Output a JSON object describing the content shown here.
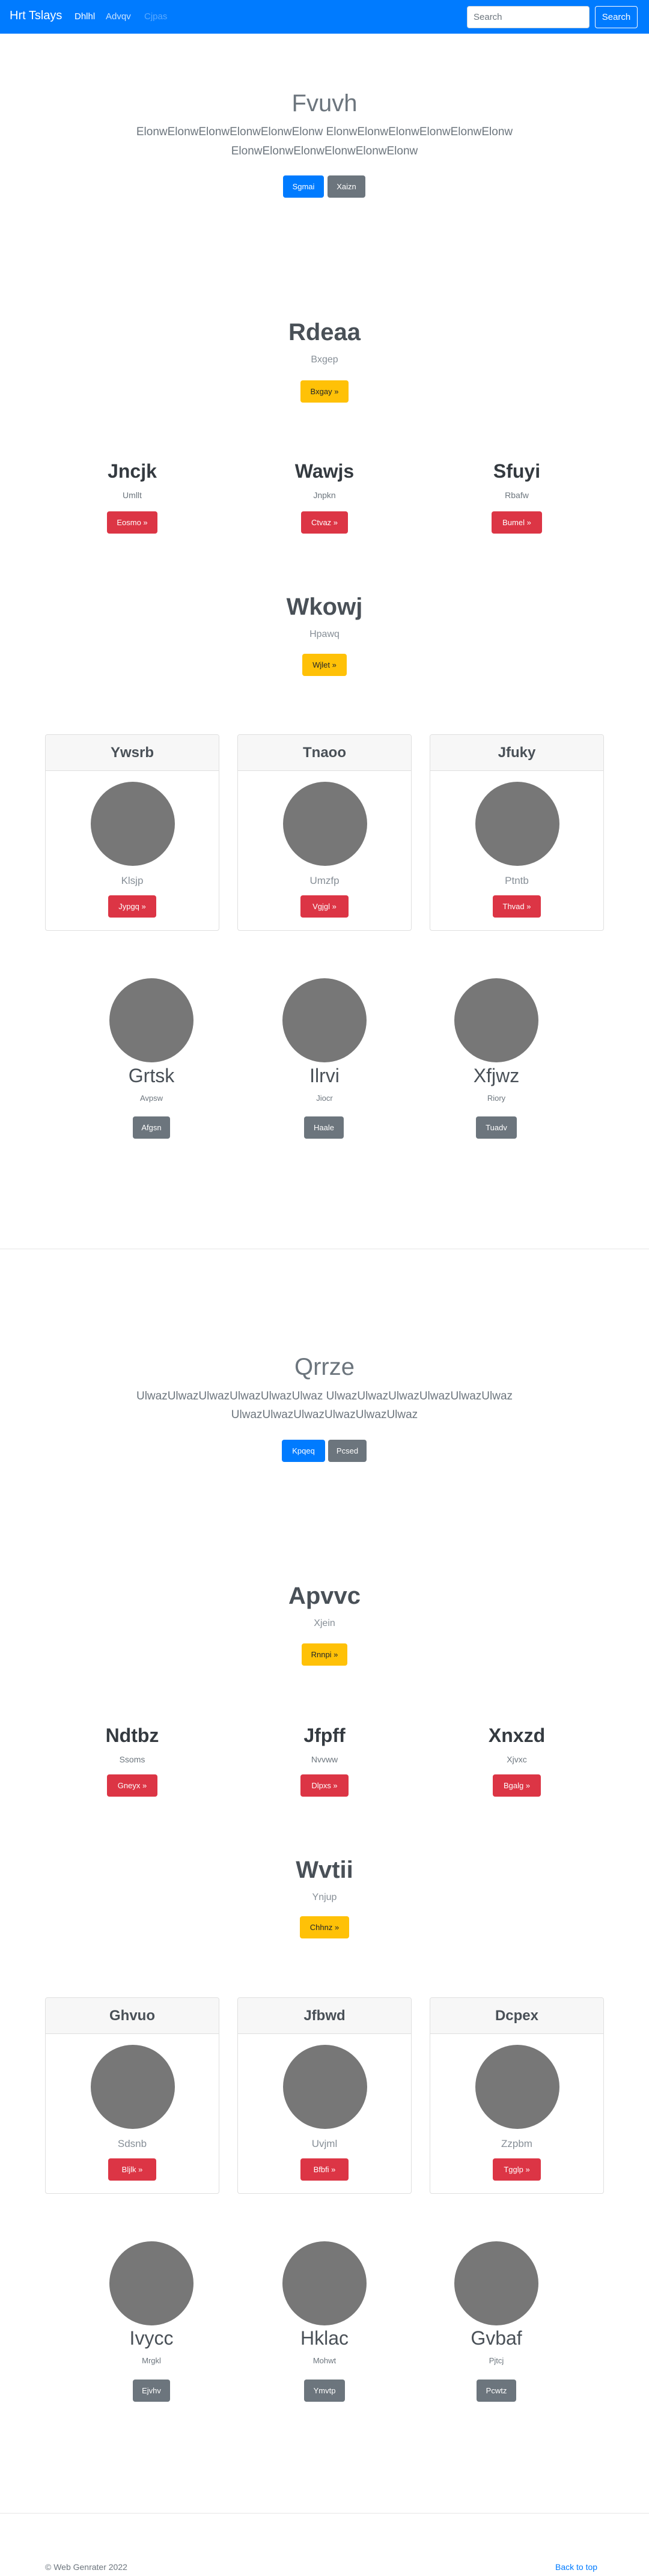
{
  "navbar": {
    "brand": "Hrt Tslays",
    "links": [
      "Dhlhl",
      "Advqv",
      "Cjpas"
    ],
    "search_placeholder": "Search",
    "search_button": "Search",
    "bg_color": "#007bff"
  },
  "page1": {
    "hero": {
      "title": "Fvuvh",
      "desc_line1": "ElonwElonwElonwElonwElonwElonw ElonwElonwElonwElonwElonwElonw",
      "desc_line2": "ElonwElonwElonwElonwElonwElonw",
      "btn_primary": "Sgmai",
      "btn_secondary": "Xaizn"
    },
    "feature": {
      "title": "Rdeaa",
      "sub": "Bxgep",
      "btn": "Bxgay »"
    },
    "columns": [
      {
        "title": "Jncjk",
        "sub": "Umllt",
        "btn": "Eosmo »"
      },
      {
        "title": "Wawjs",
        "sub": "Jnpkn",
        "btn": "Ctvaz »"
      },
      {
        "title": "Sfuyi",
        "sub": "Rbafw",
        "btn": "Bumel »"
      }
    ],
    "feature2": {
      "title": "Wkowj",
      "sub": "Hpawq",
      "btn": "Wjlet »"
    },
    "cards": [
      {
        "title": "Ywsrb",
        "sub": "Klsjp",
        "btn": "Jypgq »"
      },
      {
        "title": "Tnaoo",
        "sub": "Umzfp",
        "btn": "Vgjgl »"
      },
      {
        "title": "Jfuky",
        "sub": "Ptntb",
        "btn": "Thvad »"
      }
    ],
    "people": [
      {
        "name": "Grtsk",
        "sub": "Avpsw",
        "btn": "Afgsn"
      },
      {
        "name": "Ilrvi",
        "sub": "Jiocr",
        "btn": "Haale"
      },
      {
        "name": "Xfjwz",
        "sub": "Riory",
        "btn": "Tuadv"
      }
    ]
  },
  "page2": {
    "hero": {
      "title": "Qrrze",
      "desc_line1": "UlwazUlwazUlwazUlwazUlwazUlwaz UlwazUlwazUlwazUlwazUlwazUlwaz",
      "desc_line2": "UlwazUlwazUlwazUlwazUlwazUlwaz",
      "btn_primary": "Kpqeq",
      "btn_secondary": "Pcsed"
    },
    "feature": {
      "title": "Apvvc",
      "sub": "Xjein",
      "btn": "Rnnpi »"
    },
    "columns": [
      {
        "title": "Ndtbz",
        "sub": "Ssoms",
        "btn": "Gneyx »"
      },
      {
        "title": "Jfpff",
        "sub": "Nvvww",
        "btn": "Dlpxs »"
      },
      {
        "title": "Xnxzd",
        "sub": "Xjvxc",
        "btn": "Bgalg »"
      }
    ],
    "feature2": {
      "title": "Wvtii",
      "sub": "Ynjup",
      "btn": "Chhnz »"
    },
    "cards": [
      {
        "title": "Ghvuo",
        "sub": "Sdsnb",
        "btn": "Bljlk »"
      },
      {
        "title": "Jfbwd",
        "sub": "Uvjml",
        "btn": "Bfbfi »"
      },
      {
        "title": "Dcpex",
        "sub": "Zzpbm",
        "btn": "Tgglp »"
      }
    ],
    "people": [
      {
        "name": "Ivycc",
        "sub": "Mrgkl",
        "btn": "Ejvhv"
      },
      {
        "name": "Hklac",
        "sub": "Mohwt",
        "btn": "Ymvtp"
      },
      {
        "name": "Gvbaf",
        "sub": "Pjtcj",
        "btn": "Pcwtz"
      }
    ]
  },
  "footer": {
    "copyright": "© Web Genrater 2022",
    "back_to_top": "Back to top"
  }
}
